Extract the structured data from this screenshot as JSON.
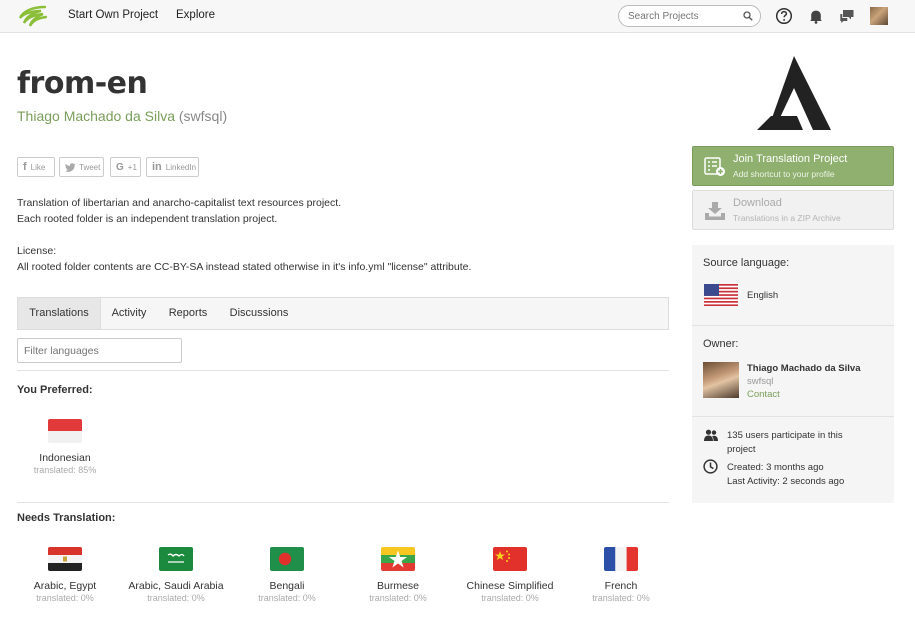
{
  "nav": {
    "start_project": "Start Own Project",
    "explore": "Explore",
    "search_placeholder": "Search Projects"
  },
  "project": {
    "title": "from-en",
    "owner_name": "Thiago Machado da Silva",
    "owner_user": "(swfsql)",
    "share": [
      "Like",
      "Tweet",
      "+1",
      "LinkedIn"
    ],
    "description": [
      "Translation of libertarian and anarcho-capitalist text resources project.",
      "Each rooted folder is an independent translation project.",
      "License:",
      "All rooted folder contents are CC-BY-SA instead stated otherwise in it's info.yml \"license\" attribute."
    ]
  },
  "tabs": [
    "Translations",
    "Activity",
    "Reports",
    "Discussions"
  ],
  "filter_placeholder": "Filter languages",
  "preferred": {
    "heading": "You Preferred:",
    "items": [
      {
        "name": "Indonesian",
        "pct": "translated: 85%"
      }
    ]
  },
  "needs": {
    "heading": "Needs Translation:",
    "items": [
      {
        "name": "Arabic, Egypt",
        "pct": "translated: 0%"
      },
      {
        "name": "Arabic, Saudi Arabia",
        "pct": "translated: 0%"
      },
      {
        "name": "Bengali",
        "pct": "translated: 0%"
      },
      {
        "name": "Burmese",
        "pct": "translated: 0%"
      },
      {
        "name": "Chinese Simplified",
        "pct": "translated: 0%"
      },
      {
        "name": "French",
        "pct": "translated: 0%"
      }
    ]
  },
  "sidebar": {
    "join_title": "Join Translation Project",
    "join_sub": "Add shortcut to your profile",
    "download_title": "Download",
    "download_sub": "Translations in a ZIP Archive",
    "source_label": "Source language:",
    "source_lang": "English",
    "owner_label": "Owner:",
    "owner_name": "Thiago Machado da Silva",
    "owner_user": "swfsql",
    "contact": "Contact",
    "participants_1": "135 users participate in this",
    "participants_2": "project",
    "created": "Created: 3 months ago",
    "last_activity": "Last Activity: 2 seconds ago"
  },
  "colors": {
    "accent_green": "#8fb06e",
    "link_green": "#7a9e5a"
  }
}
